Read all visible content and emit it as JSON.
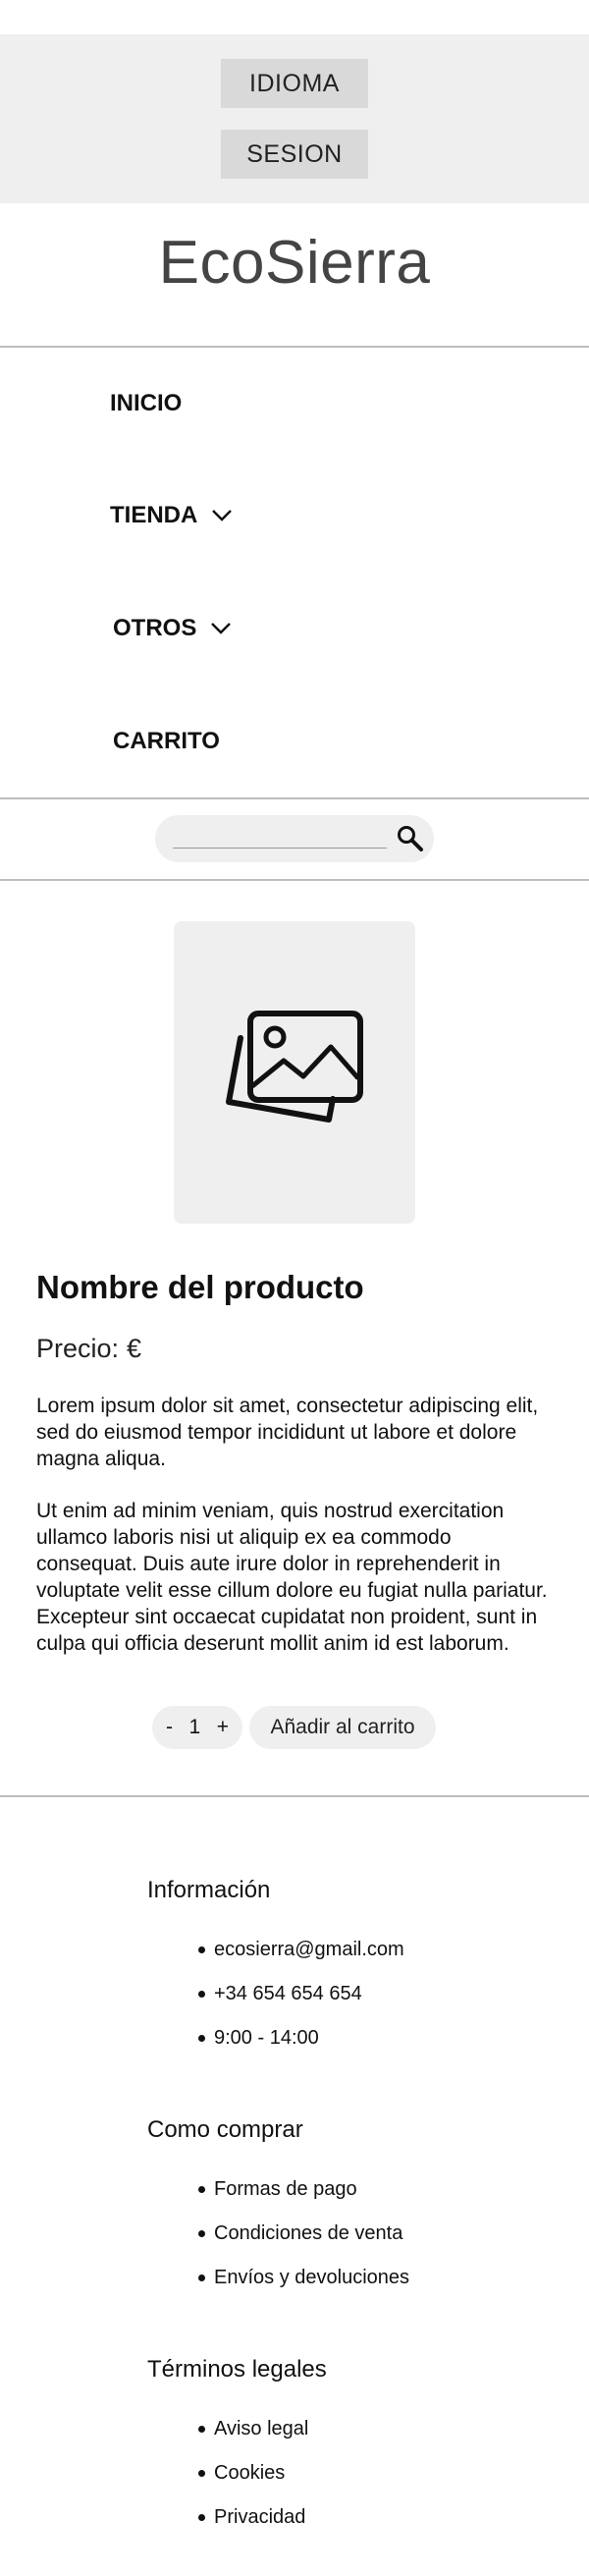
{
  "header": {
    "language_button": "IDIOMA",
    "session_button": "SESION",
    "brand": "EcoSierra"
  },
  "nav": {
    "items": [
      {
        "label": "INICIO",
        "has_dropdown": false
      },
      {
        "label": "TIENDA",
        "has_dropdown": true
      },
      {
        "label": "OTROS",
        "has_dropdown": true
      },
      {
        "label": "CARRITO",
        "has_dropdown": false
      }
    ]
  },
  "search": {
    "placeholder": "",
    "icon": "search-icon"
  },
  "product": {
    "image_icon": "image-placeholder-icon",
    "name": "Nombre del producto",
    "price_label": "Precio:",
    "price_currency": "€",
    "description_1": "Lorem ipsum dolor sit amet, consectetur adipiscing elit, sed do eiusmod tempor incididunt ut labore et dolore magna aliqua.",
    "description_2": "Ut enim ad minim veniam, quis nostrud exercitation ullamco laboris nisi ut aliquip ex ea commodo consequat. Duis aute irure dolor in reprehenderit in voluptate velit esse cillum dolore eu fugiat nulla pariatur. Excepteur sint occaecat cupidatat non proident, sunt in culpa qui officia deserunt mollit anim id est laborum.",
    "quantity": {
      "minus": "-",
      "value": "1",
      "plus": "+"
    },
    "add_to_cart": "Añadir al carrito"
  },
  "footer": {
    "sections": [
      {
        "title": "Información",
        "items": [
          "ecosierra@gmail.com",
          "+34 654 654 654",
          "9:00 - 14:00"
        ]
      },
      {
        "title": "Como comprar",
        "items": [
          "Formas de pago",
          "Condiciones de venta",
          "Envíos y devoluciones"
        ]
      },
      {
        "title": "Términos legales",
        "items": [
          "Aviso legal",
          "Cookies",
          "Privacidad"
        ]
      }
    ]
  }
}
